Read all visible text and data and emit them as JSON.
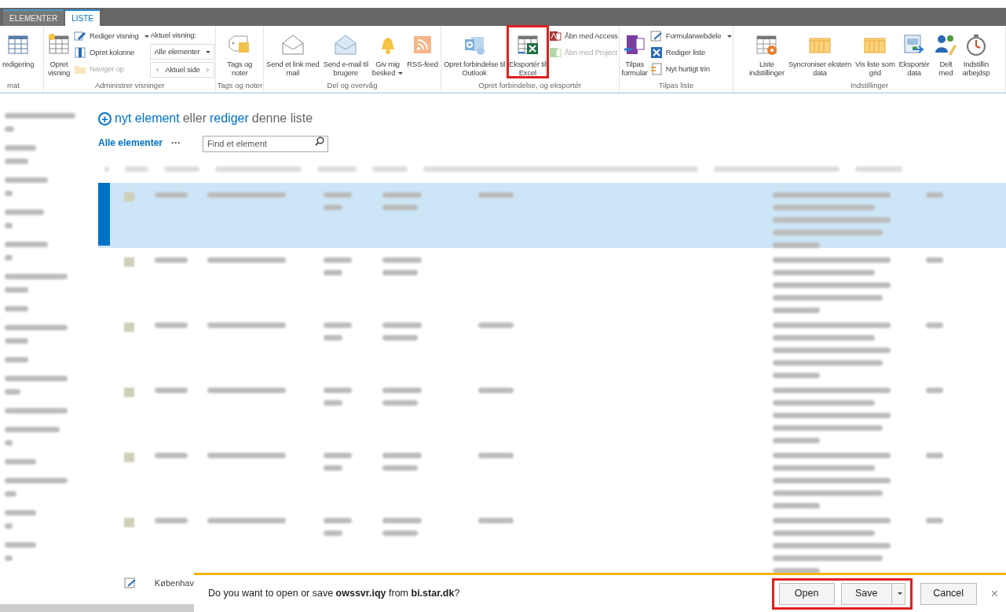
{
  "tabs": [
    {
      "label": "ELEMENTER",
      "selected": false
    },
    {
      "label": "LISTE",
      "selected": true
    }
  ],
  "ribbon": {
    "groups": [
      {
        "label": "mat",
        "items": [
          {
            "kind": "large",
            "lines": [
              "redigering"
            ],
            "disabled": false,
            "dropdown": false,
            "highlighted": false
          }
        ]
      },
      {
        "label": "Administrer visninger",
        "items": [
          {
            "kind": "large",
            "lines": [
              "Opret",
              "visning"
            ],
            "disabled": false,
            "dropdown": false,
            "highlighted": false
          },
          {
            "kind": "stack",
            "entries": [
              {
                "label": "Rediger visning",
                "disabled": false,
                "dropdown": true
              },
              {
                "label": "Opret kolonne",
                "disabled": false,
                "dropdown": false
              },
              {
                "label": "Naviger op",
                "disabled": true,
                "dropdown": false
              }
            ]
          },
          {
            "kind": "view",
            "label": "Aktuel visning:",
            "select": "Alle elementer",
            "pager": "Aktuel side"
          }
        ]
      },
      {
        "label": "Tags og noter",
        "items": [
          {
            "kind": "large",
            "lines": [
              "Tags og",
              "noter"
            ],
            "disabled": false,
            "dropdown": false,
            "highlighted": false
          }
        ]
      },
      {
        "label": "Del og overvåg",
        "items": [
          {
            "kind": "large",
            "lines": [
              "Send et link med",
              "mail"
            ],
            "disabled": false,
            "dropdown": false,
            "highlighted": false
          },
          {
            "kind": "large",
            "lines": [
              "Send e-mail til",
              "brugere"
            ],
            "disabled": false,
            "dropdown": false,
            "highlighted": false
          },
          {
            "kind": "large",
            "lines": [
              "Giv mig",
              "besked"
            ],
            "disabled": false,
            "dropdown": true,
            "highlighted": false
          },
          {
            "kind": "large",
            "lines": [
              "RSS-feed"
            ],
            "disabled": false,
            "dropdown": false,
            "highlighted": false
          }
        ]
      },
      {
        "label": "Opret forbindelse, og eksportér",
        "items": [
          {
            "kind": "large",
            "lines": [
              "Opret forbindelse til",
              "Outlook"
            ],
            "disabled": false,
            "dropdown": false,
            "highlighted": false
          },
          {
            "kind": "large",
            "lines": [
              "Eksportér til",
              "Excel"
            ],
            "disabled": false,
            "dropdown": false,
            "highlighted": true
          },
          {
            "kind": "stack",
            "entries": [
              {
                "label": "Åbn med Access",
                "disabled": false,
                "dropdown": false
              },
              {
                "label": "Åbn med Project",
                "disabled": true,
                "dropdown": false
              }
            ]
          }
        ]
      },
      {
        "label": "Tilpas liste",
        "items": [
          {
            "kind": "large",
            "lines": [
              "Tilpas",
              "formular"
            ],
            "disabled": false,
            "dropdown": false,
            "highlighted": false
          },
          {
            "kind": "stack",
            "entries": [
              {
                "label": "Formularwebdele",
                "disabled": false,
                "dropdown": true
              },
              {
                "label": "Rediger liste",
                "disabled": false,
                "dropdown": false
              },
              {
                "label": "Nyt hurtigt trin",
                "disabled": false,
                "dropdown": false
              }
            ]
          }
        ]
      },
      {
        "label": "Indstillinger",
        "items": [
          {
            "kind": "large",
            "lines": [
              "Liste",
              "indstillinger"
            ],
            "disabled": false,
            "dropdown": false,
            "highlighted": false
          },
          {
            "kind": "large",
            "lines": [
              "Syncroniser ekstern",
              "data"
            ],
            "disabled": false,
            "dropdown": false,
            "highlighted": false
          },
          {
            "kind": "large",
            "lines": [
              "Vis liste som",
              "grid"
            ],
            "disabled": false,
            "dropdown": false,
            "highlighted": false
          },
          {
            "kind": "large",
            "lines": [
              "Eksportér",
              "data"
            ],
            "disabled": false,
            "dropdown": false,
            "highlighted": false
          },
          {
            "kind": "large",
            "lines": [
              "Delt",
              "med"
            ],
            "disabled": false,
            "dropdown": false,
            "highlighted": false
          },
          {
            "kind": "large",
            "lines": [
              "Indstillin",
              "arbejdsp"
            ],
            "disabled": false,
            "dropdown": false,
            "highlighted": false
          }
        ]
      }
    ]
  },
  "list": {
    "new_item": {
      "plus": "+",
      "link1": "nyt element",
      "text1": "eller",
      "link2": "rediger",
      "text2": "denne liste"
    },
    "view": "Alle elementer",
    "more": "···",
    "search": {
      "placeholder": "Find et element"
    },
    "rows": [
      {
        "selected": true
      },
      {
        "selected": false
      },
      {
        "selected": false
      },
      {
        "selected": false
      },
      {
        "selected": false
      },
      {
        "selected": false
      },
      {
        "selected": false,
        "column_1": "Københav"
      }
    ]
  },
  "download_bar": {
    "message": "Do you want to open or save **owssvr.iqy** from **bi.star.dk**?",
    "buttons": [
      {
        "label": "Open",
        "highlighted": true
      },
      {
        "label": "Save",
        "highlighted": true,
        "dropdown": true
      },
      {
        "label": "Cancel",
        "highlighted": false
      }
    ],
    "close": "×"
  }
}
